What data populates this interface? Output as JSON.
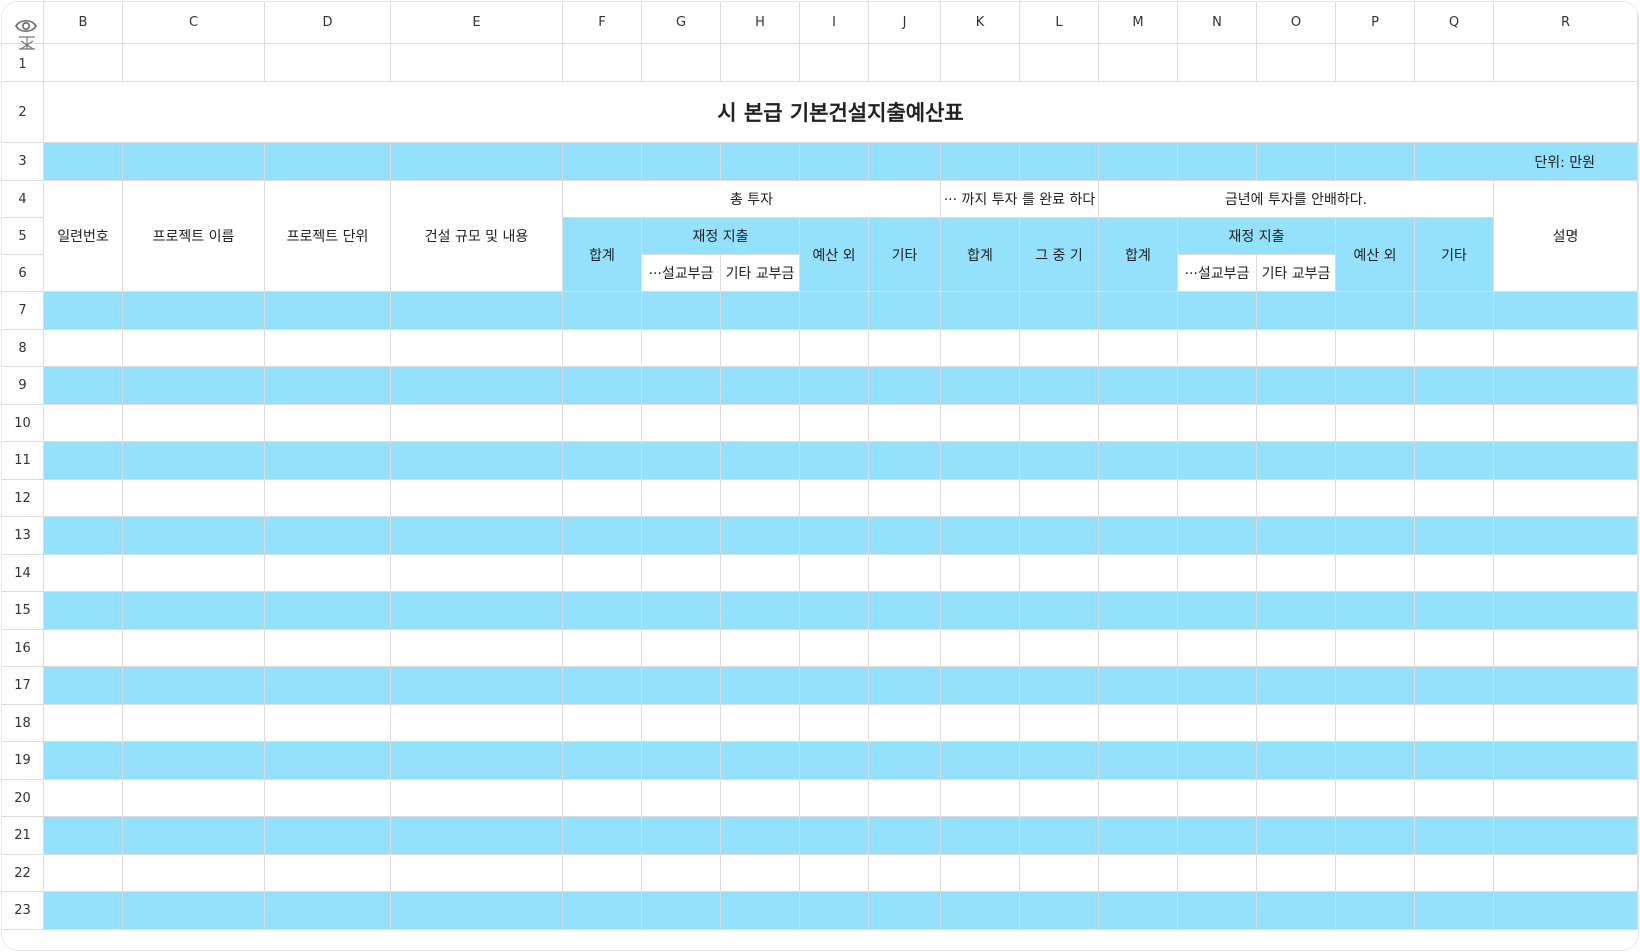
{
  "column_headers": [
    "B",
    "C",
    "D",
    "E",
    "F",
    "G",
    "H",
    "I",
    "J",
    "K",
    "L",
    "M",
    "N",
    "O",
    "P",
    "Q",
    "R"
  ],
  "row_numbers": [
    "1",
    "2",
    "3",
    "4",
    "5",
    "6",
    "7",
    "8",
    "9",
    "10",
    "11",
    "12",
    "13",
    "14",
    "15",
    "16",
    "17",
    "18",
    "19",
    "20",
    "21",
    "22",
    "23"
  ],
  "sheet": {
    "title": "시 본급 기본건설지출예산표",
    "unit_label": "단위: 만원",
    "headers": {
      "serial": "일련번호",
      "project_name": "프로젝트 이름",
      "project_unit": "프로젝트 단위",
      "construction_scope": "건설 규모 및 내용",
      "total_investment": "총 투자",
      "completed_by": "··· 까지 투자 를 완료 하다",
      "this_year": "금년에 투자를 안배하다.",
      "description": "설명",
      "sum_f": "합계",
      "fiscal_g": "재정 지출",
      "budget_out_i": "예산 외",
      "other_j": "기타",
      "sum_k": "합계",
      "among_l": "그 중 기",
      "sum_m": "합계",
      "fiscal_n": "재정 지출",
      "budget_out_p": "예산 외",
      "other_q": "기타",
      "sub_g": "···설교부금",
      "sub_h": "기타 교부금",
      "sub_n": "···설교부금",
      "sub_o": "기타 교부금"
    }
  },
  "icons": {
    "view": "eye-icon",
    "freeze": "freeze-panes-icon"
  },
  "colors": {
    "band": "#93e1fd",
    "grid_line": "#dcdcdc"
  }
}
